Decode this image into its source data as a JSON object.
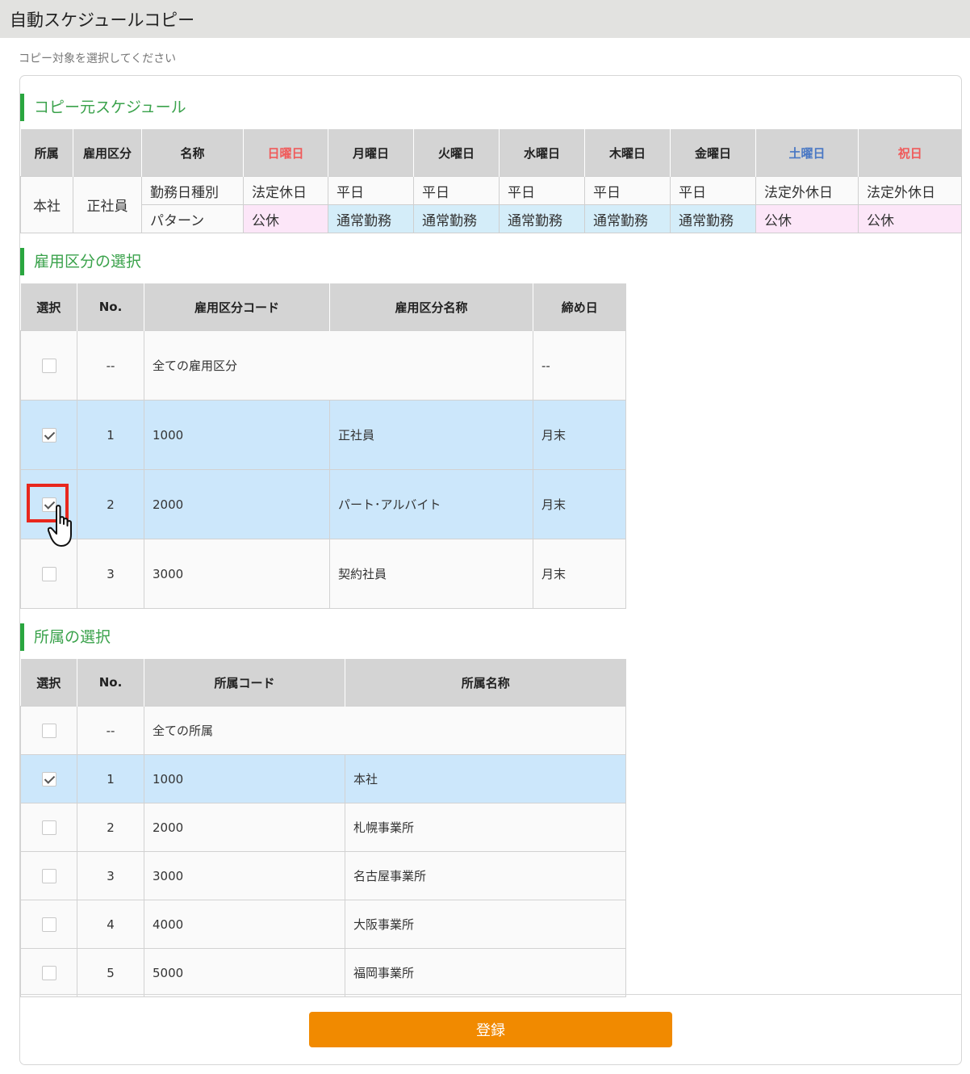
{
  "page": {
    "title": "自動スケジュールコピー",
    "subtitle": "コピー対象を選択してください"
  },
  "source": {
    "heading": "コピー元スケジュール",
    "headers": {
      "affiliation": "所属",
      "employment": "雇用区分",
      "name": "名称",
      "days": [
        "日曜日",
        "月曜日",
        "火曜日",
        "水曜日",
        "木曜日",
        "金曜日",
        "土曜日",
        "祝日"
      ]
    },
    "affiliation": "本社",
    "employment": "正社員",
    "row_daytype_label": "勤務日種別",
    "row_pattern_label": "パターン",
    "daytypes": [
      "法定休日",
      "平日",
      "平日",
      "平日",
      "平日",
      "平日",
      "法定外休日",
      "法定外休日"
    ],
    "patterns": [
      "公休",
      "通常勤務",
      "通常勤務",
      "通常勤務",
      "通常勤務",
      "通常勤務",
      "公休",
      "公休"
    ],
    "colors": {
      "sunday_holiday": "#f05a5a",
      "saturday": "#4a78c4",
      "rest_bg": "#fce6f8",
      "work_bg": "#d4edf9"
    }
  },
  "employment_select": {
    "heading": "雇用区分の選択",
    "headers": {
      "select": "選択",
      "no": "No.",
      "code": "雇用区分コード",
      "name": "雇用区分名称",
      "closing": "締め日"
    },
    "all_row": {
      "no": "--",
      "label": "全ての雇用区分",
      "closing": "--",
      "checked": false
    },
    "rows": [
      {
        "no": "1",
        "code": "1000",
        "name": "正社員",
        "closing": "月末",
        "checked": true
      },
      {
        "no": "2",
        "code": "2000",
        "name": "パート･アルバイト",
        "closing": "月末",
        "checked": true
      },
      {
        "no": "3",
        "code": "3000",
        "name": "契約社員",
        "closing": "月末",
        "checked": false
      }
    ]
  },
  "affiliation_select": {
    "heading": "所属の選択",
    "headers": {
      "select": "選択",
      "no": "No.",
      "code": "所属コード",
      "name": "所属名称"
    },
    "all_row": {
      "no": "--",
      "label": "全ての所属",
      "checked": false
    },
    "rows": [
      {
        "no": "1",
        "code": "1000",
        "name": "本社",
        "checked": true
      },
      {
        "no": "2",
        "code": "2000",
        "name": "札幌事業所",
        "checked": false
      },
      {
        "no": "3",
        "code": "3000",
        "name": "名古屋事業所",
        "checked": false
      },
      {
        "no": "4",
        "code": "4000",
        "name": "大阪事業所",
        "checked": false
      },
      {
        "no": "5",
        "code": "5000",
        "name": "福岡事業所",
        "checked": false
      }
    ]
  },
  "footer": {
    "register_label": "登録",
    "button_color": "#f18a00"
  }
}
